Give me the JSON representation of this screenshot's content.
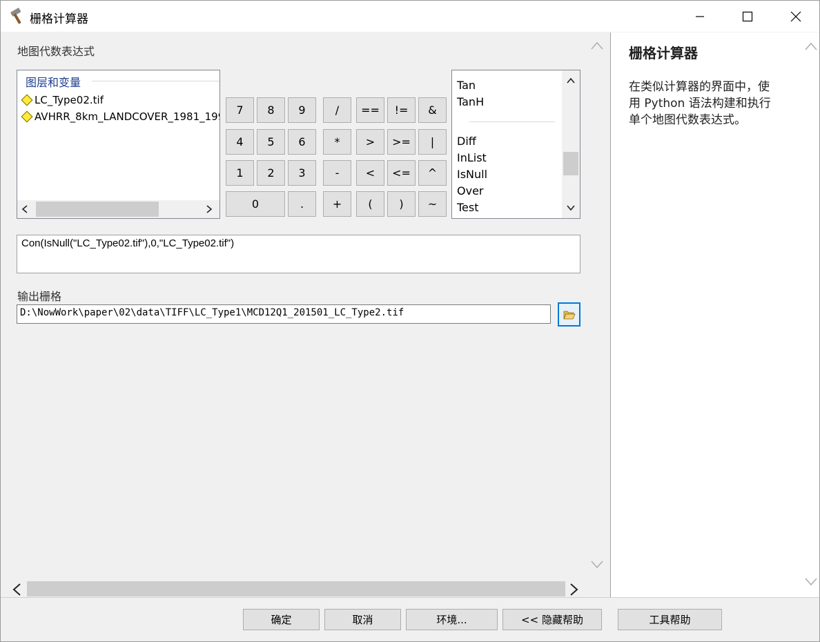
{
  "window": {
    "title": "栅格计算器",
    "icon": "hammer-icon",
    "controls": [
      "minimize-icon",
      "maximize-icon",
      "close-icon"
    ]
  },
  "expression_section": {
    "label": "地图代数表达式"
  },
  "layers": {
    "header": "图层和变量",
    "items": [
      "LC_Type02.tif",
      "AVHRR_8km_LANDCOVER_1981_199"
    ]
  },
  "calculator": {
    "buttons": [
      "7",
      "8",
      "9",
      "/",
      "==",
      "!=",
      "&",
      "4",
      "5",
      "6",
      "*",
      ">",
      ">=",
      "|",
      "1",
      "2",
      "3",
      "-",
      "<",
      "<=",
      "^",
      "0",
      ".",
      "+",
      "(",
      ")",
      "~"
    ]
  },
  "functions": {
    "items": [
      "Tan",
      "TanH",
      "Diff",
      "InList",
      "IsNull",
      "Over",
      "Test"
    ],
    "scroll_fraction": 0.72
  },
  "expression": {
    "value": "Con(IsNull(\"LC_Type02.tif\"),0,\"LC_Type02.tif\")"
  },
  "output": {
    "label": "输出栅格",
    "path": "D:\\NowWork\\paper\\02\\data\\TIFF\\LC_Type1\\MCD12Q1_201501_LC_Type2.tif",
    "browse_icon": "folder-open-icon"
  },
  "help": {
    "title": "栅格计算器",
    "line1": "在类似计算器的界面中，使",
    "line2": "用 Python 语法构建和执行",
    "line3": "单个地图代数表达式。"
  },
  "footer": {
    "ok": "确定",
    "cancel": "取消",
    "env": "环境...",
    "hide_help": "<< 隐藏帮助",
    "tool_help": "工具帮助"
  },
  "colors": {
    "accent": "#0078d7",
    "layer_header": "#1f3f8f",
    "diamond": "#ffeb3b"
  }
}
